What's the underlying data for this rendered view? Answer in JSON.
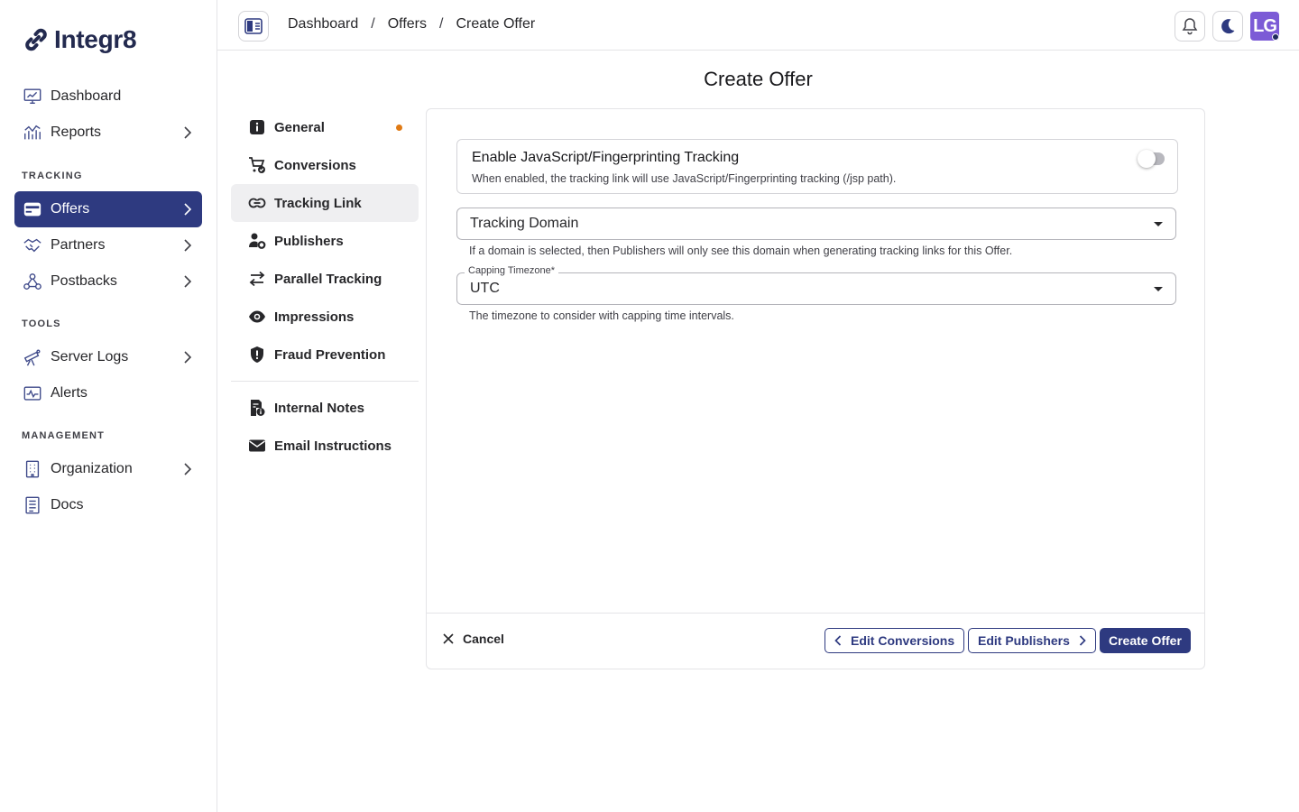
{
  "brand": {
    "name": "Integr8",
    "logo_icon": "link-chain-icon"
  },
  "sidebar": {
    "items": [
      {
        "label": "Dashboard",
        "icon": "dashboard-chart-icon"
      },
      {
        "label": "Reports",
        "icon": "bar-chart-icon",
        "has_children": true
      }
    ],
    "sections": [
      {
        "title": "TRACKING",
        "items": [
          {
            "label": "Offers",
            "icon": "offers-icon",
            "active": true,
            "has_children": true
          },
          {
            "label": "Partners",
            "icon": "handshake-icon",
            "has_children": true
          },
          {
            "label": "Postbacks",
            "icon": "webhook-icon",
            "has_children": true
          }
        ]
      },
      {
        "title": "TOOLS",
        "items": [
          {
            "label": "Server Logs",
            "icon": "telescope-icon",
            "has_children": true
          },
          {
            "label": "Alerts",
            "icon": "pulse-monitor-icon"
          }
        ]
      },
      {
        "title": "MANAGEMENT",
        "items": [
          {
            "label": "Organization",
            "icon": "building-icon",
            "has_children": true
          },
          {
            "label": "Docs",
            "icon": "document-icon"
          }
        ]
      }
    ]
  },
  "header": {
    "breadcrumb": [
      "Dashboard",
      "Offers",
      "Create Offer"
    ],
    "breadcrumb_separator": "/",
    "avatar_initials": "LG"
  },
  "page": {
    "title": "Create Offer"
  },
  "subnav": {
    "items": [
      {
        "label": "General",
        "icon": "info-icon",
        "indicator": true
      },
      {
        "label": "Conversions",
        "icon": "cart-check-icon"
      },
      {
        "label": "Tracking Link",
        "icon": "link-icon",
        "active": true
      },
      {
        "label": "Publishers",
        "icon": "user-gear-icon"
      },
      {
        "label": "Parallel Tracking",
        "icon": "arrows-left-right-icon"
      },
      {
        "label": "Impressions",
        "icon": "eye-icon"
      },
      {
        "label": "Fraud Prevention",
        "icon": "shield-alert-icon"
      }
    ],
    "secondary_items": [
      {
        "label": "Internal Notes",
        "icon": "note-info-icon"
      },
      {
        "label": "Email Instructions",
        "icon": "envelope-icon"
      }
    ]
  },
  "form": {
    "js_tracking": {
      "title": "Enable JavaScript/Fingerprinting Tracking",
      "description": "When enabled, the tracking link will use JavaScript/Fingerprinting tracking (/jsp path).",
      "enabled": false
    },
    "tracking_domain": {
      "placeholder": "Tracking Domain",
      "helper": "If a domain is selected, then Publishers will only see this domain when generating tracking links for this Offer."
    },
    "capping_timezone": {
      "label": "Capping Timezone",
      "required_mark": "*",
      "value": "UTC",
      "helper": "The timezone to consider with capping time intervals."
    }
  },
  "footer": {
    "cancel_label": "Cancel",
    "prev_label": "Edit Conversions",
    "next_label": "Edit Publishers",
    "submit_label": "Create Offer"
  },
  "colors": {
    "primary": "#2e3a80",
    "indicator": "#e07a14",
    "avatar": "#7c5bd6"
  }
}
